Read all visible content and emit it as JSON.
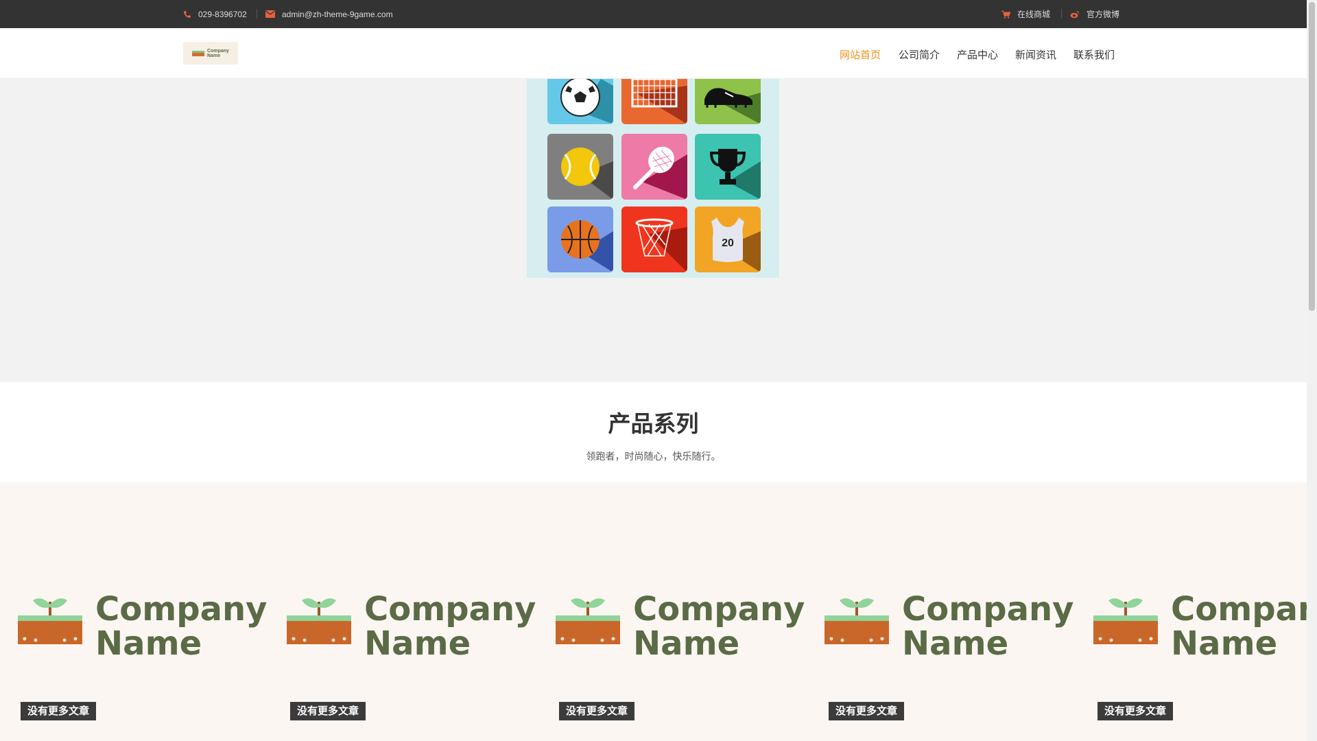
{
  "topbar": {
    "phone": "029-8396702",
    "email": "admin@zh-theme-9game.com",
    "shop": "在线商城",
    "weibo": "官方微博",
    "phone_icon": "phone-icon",
    "email_icon": "envelope-icon",
    "shop_icon": "cart-icon",
    "weibo_icon": "weibo-icon"
  },
  "nav": {
    "items": [
      {
        "label": "网站首页",
        "active": true
      },
      {
        "label": "公司简介"
      },
      {
        "label": "产品中心"
      },
      {
        "label": "新闻资讯"
      },
      {
        "label": "联系我们"
      }
    ]
  },
  "section": {
    "title": "产品系列",
    "subtitle": "领跑者，时尚随心，快乐随行。"
  },
  "products": {
    "items": [
      {
        "name1": "Company",
        "name2": "Name",
        "tag": "没有更多文章"
      },
      {
        "name1": "Company",
        "name2": "Name",
        "tag": "没有更多文章"
      },
      {
        "name1": "Company",
        "name2": "Name",
        "tag": "没有更多文章"
      },
      {
        "name1": "Company",
        "name2": "Name",
        "tag": "没有更多文章"
      },
      {
        "name1": "Compan",
        "name2": "Name",
        "tag": "没有更多文章"
      }
    ]
  },
  "colors": {
    "accent": "#f0901e",
    "topbar_bg": "#333333",
    "icon_orange": "#e8613e"
  }
}
